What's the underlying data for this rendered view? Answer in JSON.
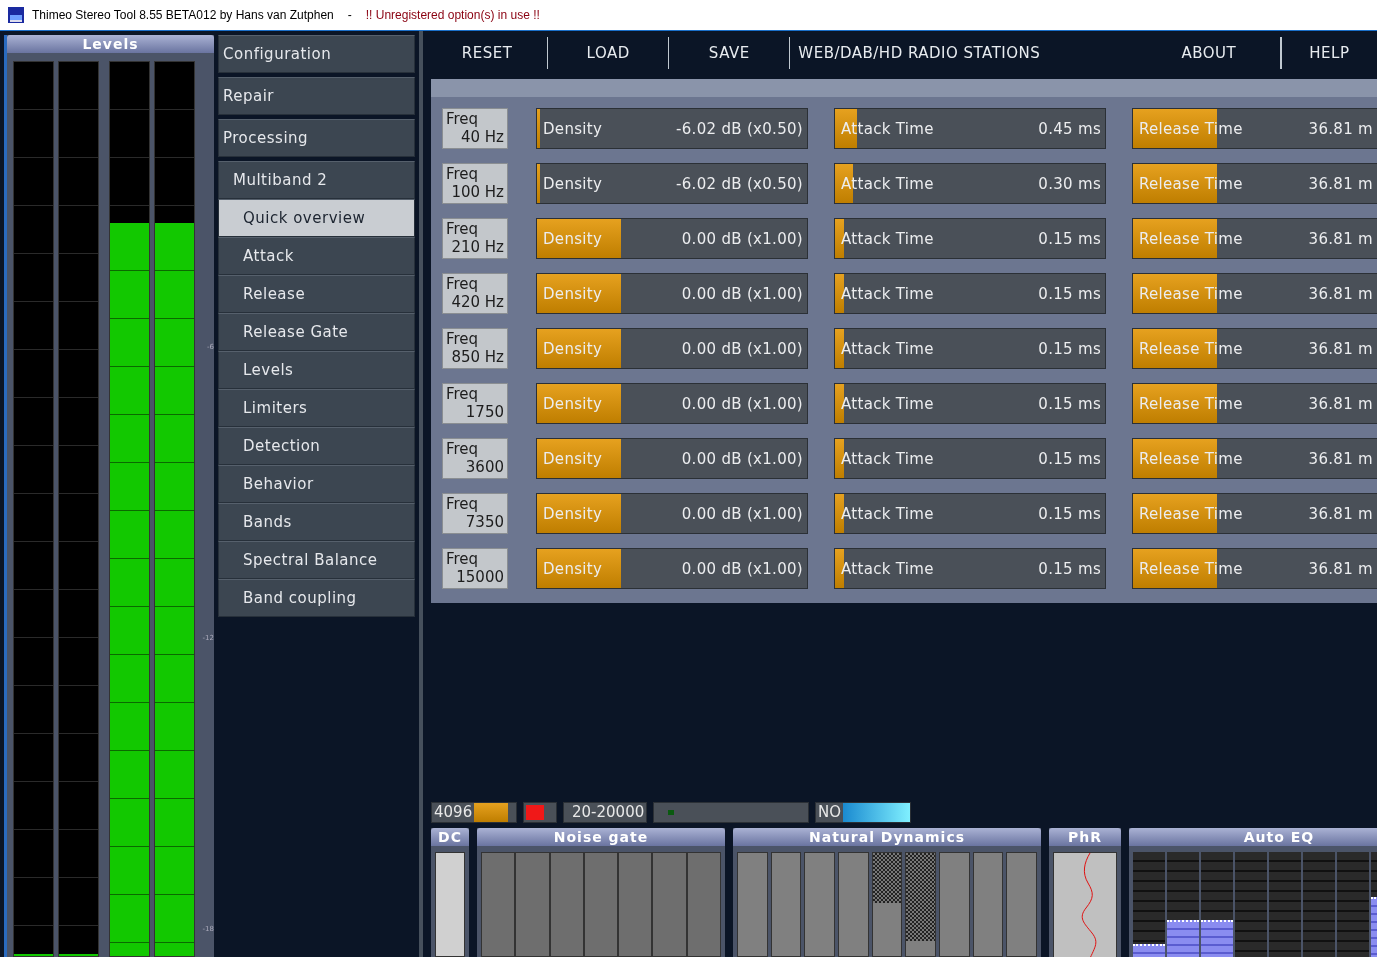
{
  "window": {
    "title": "Thimeo Stereo Tool 8.55 BETA012 by Hans van Zutphen",
    "separator": "-",
    "warning": "!! Unregistered option(s) in use !!"
  },
  "levels": {
    "title": "Levels",
    "meters": [
      {
        "level": 0
      },
      {
        "level": 0
      },
      {
        "level": 0.82
      },
      {
        "level": 0.82
      }
    ],
    "scale": [
      "-6",
      "-12",
      "-18"
    ]
  },
  "menu": [
    {
      "label": "Configuration",
      "selected": false
    },
    {
      "label": "Repair",
      "selected": false
    },
    {
      "label": "Processing",
      "selected": false,
      "children": [
        {
          "label": "Multiband 2",
          "selected": false,
          "children": [
            {
              "label": "Quick overview",
              "selected": true
            },
            {
              "label": "Attack",
              "selected": false
            },
            {
              "label": "Release",
              "selected": false
            },
            {
              "label": "Release Gate",
              "selected": false
            },
            {
              "label": "Levels",
              "selected": false
            },
            {
              "label": "Limiters",
              "selected": false
            },
            {
              "label": "Detection",
              "selected": false
            },
            {
              "label": "Behavior",
              "selected": false
            },
            {
              "label": "Bands",
              "selected": false
            },
            {
              "label": "Spectral Balance",
              "selected": false
            },
            {
              "label": "Band coupling",
              "selected": false
            }
          ]
        }
      ]
    }
  ],
  "toolbar": [
    "RESET",
    "LOAD",
    "SAVE",
    "WEB/DAB/HD RADIO STATIONS",
    "ABOUT",
    "HELP"
  ],
  "bands": [
    {
      "freq_label": "Freq",
      "freq": "40 Hz",
      "density": {
        "label": "Density",
        "value": "-6.02 dB (x0.50)",
        "level": 0.01
      },
      "attack": {
        "label": "Attack Time",
        "value": "0.45 ms",
        "level": 0.08
      },
      "release": {
        "label": "Release Time",
        "value": "36.81 m",
        "level": 0.31
      }
    },
    {
      "freq_label": "Freq",
      "freq": "100 Hz",
      "density": {
        "label": "Density",
        "value": "-6.02 dB (x0.50)",
        "level": 0.01
      },
      "attack": {
        "label": "Attack Time",
        "value": "0.30 ms",
        "level": 0.065
      },
      "release": {
        "label": "Release Time",
        "value": "36.81 m",
        "level": 0.31
      }
    },
    {
      "freq_label": "Freq",
      "freq": "210 Hz",
      "density": {
        "label": "Density",
        "value": "0.00 dB (x1.00)",
        "level": 0.31
      },
      "attack": {
        "label": "Attack Time",
        "value": "0.15 ms",
        "level": 0.035
      },
      "release": {
        "label": "Release Time",
        "value": "36.81 m",
        "level": 0.31
      }
    },
    {
      "freq_label": "Freq",
      "freq": "420 Hz",
      "density": {
        "label": "Density",
        "value": "0.00 dB (x1.00)",
        "level": 0.31
      },
      "attack": {
        "label": "Attack Time",
        "value": "0.15 ms",
        "level": 0.035
      },
      "release": {
        "label": "Release Time",
        "value": "36.81 m",
        "level": 0.31
      }
    },
    {
      "freq_label": "Freq",
      "freq": "850 Hz",
      "density": {
        "label": "Density",
        "value": "0.00 dB (x1.00)",
        "level": 0.31
      },
      "attack": {
        "label": "Attack Time",
        "value": "0.15 ms",
        "level": 0.035
      },
      "release": {
        "label": "Release Time",
        "value": "36.81 m",
        "level": 0.31
      }
    },
    {
      "freq_label": "Freq",
      "freq": "1750",
      "density": {
        "label": "Density",
        "value": "0.00 dB (x1.00)",
        "level": 0.31
      },
      "attack": {
        "label": "Attack Time",
        "value": "0.15 ms",
        "level": 0.035
      },
      "release": {
        "label": "Release Time",
        "value": "36.81 m",
        "level": 0.31
      }
    },
    {
      "freq_label": "Freq",
      "freq": "3600",
      "density": {
        "label": "Density",
        "value": "0.00 dB (x1.00)",
        "level": 0.31
      },
      "attack": {
        "label": "Attack Time",
        "value": "0.15 ms",
        "level": 0.035
      },
      "release": {
        "label": "Release Time",
        "value": "36.81 m",
        "level": 0.31
      }
    },
    {
      "freq_label": "Freq",
      "freq": "7350",
      "density": {
        "label": "Density",
        "value": "0.00 dB (x1.00)",
        "level": 0.31
      },
      "attack": {
        "label": "Attack Time",
        "value": "0.15 ms",
        "level": 0.035
      },
      "release": {
        "label": "Release Time",
        "value": "36.81 m",
        "level": 0.31
      }
    },
    {
      "freq_label": "Freq",
      "freq": "15000",
      "density": {
        "label": "Density",
        "value": "0.00 dB (x1.00)",
        "level": 0.31
      },
      "attack": {
        "label": "Attack Time",
        "value": "0.15 ms",
        "level": 0.035
      },
      "release": {
        "label": "Release Time",
        "value": "36.81 m",
        "level": 0.31
      }
    }
  ],
  "status": {
    "fft": {
      "value": "4096",
      "level": 0.8
    },
    "range": "20-20000",
    "mode": {
      "value": "NO"
    }
  },
  "panels": [
    {
      "kind": "dc",
      "title": "DC"
    },
    {
      "kind": "gate",
      "title": "Noise gate"
    },
    {
      "kind": "dynamics",
      "title": "Natural Dynamics"
    },
    {
      "kind": "phase",
      "title": "PhR"
    },
    {
      "kind": "eq",
      "title": "Auto EQ"
    }
  ]
}
